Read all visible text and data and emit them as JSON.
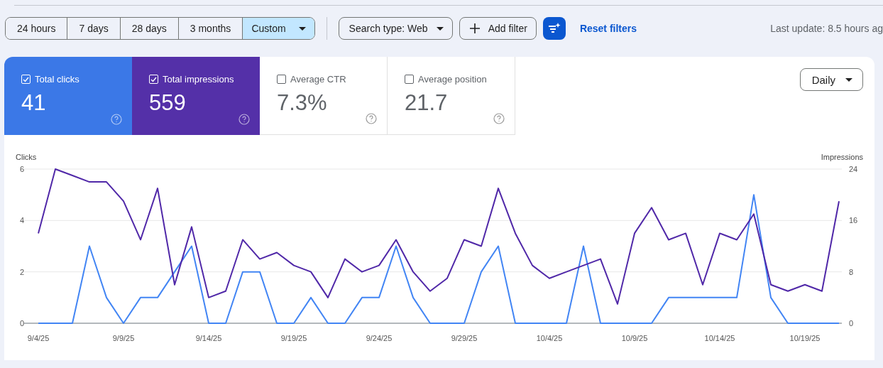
{
  "toolbar": {
    "ranges": [
      {
        "label": "24 hours",
        "selected": false
      },
      {
        "label": "7 days",
        "selected": false
      },
      {
        "label": "28 days",
        "selected": false
      },
      {
        "label": "3 months",
        "selected": false
      },
      {
        "label": "Custom",
        "selected": true,
        "dropdown": true
      }
    ],
    "search_type": "Search type: Web",
    "add_filter": "Add filter",
    "reset": "Reset filters",
    "last_update": "Last update: 8.5 hours ag"
  },
  "metrics": [
    {
      "label": "Total clicks",
      "value": "41",
      "checked": true,
      "color": "#3b78e7"
    },
    {
      "label": "Total impressions",
      "value": "559",
      "checked": true,
      "color": "#5430a8"
    },
    {
      "label": "Average CTR",
      "value": "7.3%",
      "checked": false
    },
    {
      "label": "Average position",
      "value": "21.7",
      "checked": false
    }
  ],
  "granularity": "Daily",
  "chart_data": {
    "type": "line",
    "ylabel": "Clicks",
    "y2label": "Impressions",
    "ylim": [
      0,
      6
    ],
    "yticks": [
      0,
      2,
      4,
      6
    ],
    "y2lim": [
      0,
      24
    ],
    "y2ticks": [
      0,
      8,
      16,
      24
    ],
    "categories": [
      "9/4/25",
      null,
      null,
      null,
      null,
      "9/9/25",
      null,
      null,
      null,
      null,
      "9/14/25",
      null,
      null,
      null,
      null,
      "9/19/25",
      null,
      null,
      null,
      null,
      "9/24/25",
      null,
      null,
      null,
      null,
      "9/29/25",
      null,
      null,
      null,
      null,
      "10/4/25",
      null,
      null,
      null,
      null,
      "10/9/25",
      null,
      null,
      null,
      null,
      "10/14/25",
      null,
      null,
      null,
      null,
      "10/19/25",
      null,
      null
    ],
    "series": [
      {
        "color": "#4285f4",
        "values": [
          0,
          0,
          0,
          3,
          1,
          0,
          1,
          1,
          2,
          3,
          0,
          0,
          2,
          2,
          0,
          0,
          1,
          0,
          0,
          1,
          1,
          3,
          1,
          0,
          0,
          0,
          2,
          3,
          0,
          0,
          0,
          0,
          3,
          0,
          0,
          0,
          0,
          1,
          1,
          1,
          1,
          1,
          5,
          1,
          0,
          0,
          0,
          0
        ]
      },
      {
        "color": "#5028a8",
        "axis": "y2",
        "values": [
          14,
          24,
          23,
          22,
          22,
          19,
          13,
          21,
          6,
          15,
          4,
          5,
          13,
          10,
          11,
          9,
          8,
          4,
          10,
          8,
          9,
          13,
          8,
          5,
          7,
          13,
          12,
          21,
          14,
          9,
          7,
          8,
          9,
          10,
          3,
          14,
          18,
          13,
          14,
          6,
          14,
          13,
          17,
          6,
          5,
          6,
          5,
          19
        ]
      }
    ]
  }
}
